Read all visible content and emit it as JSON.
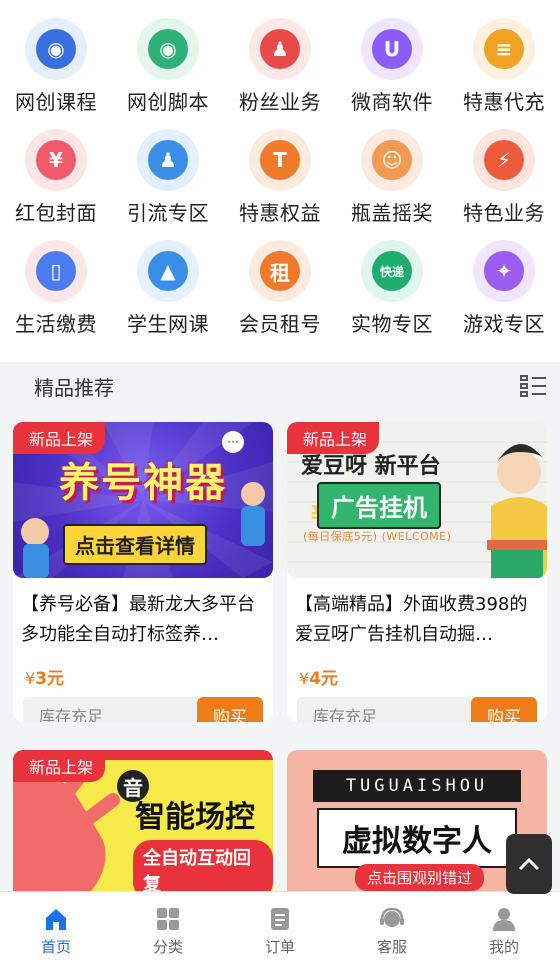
{
  "grid": [
    {
      "label": "网创课程",
      "icon": "globe-user-icon",
      "bg": "#e6eefc",
      "fg": "#3a6fe0",
      "glyph": "◉"
    },
    {
      "label": "网创脚本",
      "icon": "globe-script-icon",
      "bg": "#e4f5ec",
      "fg": "#2fb07a",
      "glyph": "◉"
    },
    {
      "label": "粉丝业务",
      "icon": "user-fans-icon",
      "bg": "#fde7e7",
      "fg": "#e84a4a",
      "glyph": "♟"
    },
    {
      "label": "微商软件",
      "icon": "u-app-icon",
      "bg": "#efe6fd",
      "fg": "#8b5cf6",
      "glyph": "U"
    },
    {
      "label": "特惠代充",
      "icon": "coins-stack-icon",
      "bg": "#fdf1de",
      "fg": "#f0a323",
      "glyph": "≡"
    },
    {
      "label": "红包封面",
      "icon": "red-envelope-icon",
      "bg": "#fde5e8",
      "fg": "#f05a6b",
      "glyph": "¥"
    },
    {
      "label": "引流专区",
      "icon": "users-group-icon",
      "bg": "#e4effd",
      "fg": "#3b8ee8",
      "glyph": "♟"
    },
    {
      "label": "特惠权益",
      "icon": "t-badge-icon",
      "bg": "#fdeadc",
      "fg": "#f07a2a",
      "glyph": "T"
    },
    {
      "label": "瓶盖摇奖",
      "icon": "smile-face-icon",
      "bg": "#fdeadf",
      "fg": "#f39a52",
      "glyph": "☺"
    },
    {
      "label": "特色业务",
      "icon": "alarm-clock-icon",
      "bg": "#fde4df",
      "fg": "#ee5a3c",
      "glyph": "⚡"
    },
    {
      "label": "生活缴费",
      "icon": "phone-bill-icon",
      "bg": "#fde6e8",
      "fg": "#4a7cf0",
      "glyph": "▯"
    },
    {
      "label": "学生网课",
      "icon": "graduation-cap-icon",
      "bg": "#e4f0fd",
      "fg": "#3b8ee8",
      "glyph": "▲"
    },
    {
      "label": "会员租号",
      "icon": "rent-badge-icon",
      "bg": "#fdeadf",
      "fg": "#f07a2a",
      "glyph": "租"
    },
    {
      "label": "实物专区",
      "icon": "delivery-scooter-icon",
      "bg": "#e0f5ec",
      "fg": "#1fae6f",
      "glyph": "快递"
    },
    {
      "label": "游戏专区",
      "icon": "gamepad-icon",
      "bg": "#efe6fd",
      "fg": "#9b5cf0",
      "glyph": "✦"
    }
  ],
  "section": {
    "title": "精品推荐"
  },
  "products": [
    {
      "tag": "新品上架",
      "title": "【养号必备】最新龙大多平台多功能全自动打标签养…",
      "price_symbol": "¥",
      "price": "3元",
      "stock": "库存充足",
      "buy": "购买",
      "banner_main": "养号神器",
      "banner_sub": "点击查看详情"
    },
    {
      "tag": "新品上架",
      "title": "【高端精品】外面收费398的爱豆呀广告挂机自动掘…",
      "price_symbol": "¥",
      "price": "4元",
      "stock": "库存充足",
      "buy": "购买",
      "banner_main": "广告挂机",
      "banner_top": "爱豆呀 新平台",
      "banner_sub": "(每日保底5元) (WELCOME)"
    },
    {
      "tag": "新品上架",
      "banner_main": "智能场控",
      "banner_sub": "全自动互动回复",
      "banner_mark": "音"
    },
    {
      "tag": "",
      "banner_top": "TUGUAISHOU",
      "banner_main": "虚拟数字人",
      "banner_sub": "点击围观别错过"
    }
  ],
  "nav": [
    {
      "label": "首页",
      "icon": "home-icon",
      "active": true
    },
    {
      "label": "分类",
      "icon": "category-grid-icon",
      "active": false
    },
    {
      "label": "订单",
      "icon": "order-list-icon",
      "active": false
    },
    {
      "label": "客服",
      "icon": "customer-service-icon",
      "active": false
    },
    {
      "label": "我的",
      "icon": "profile-icon",
      "active": false
    }
  ],
  "colors": {
    "accent": "#ee7d17",
    "tag": "#e8323c",
    "nav_active": "#1a73e8"
  }
}
